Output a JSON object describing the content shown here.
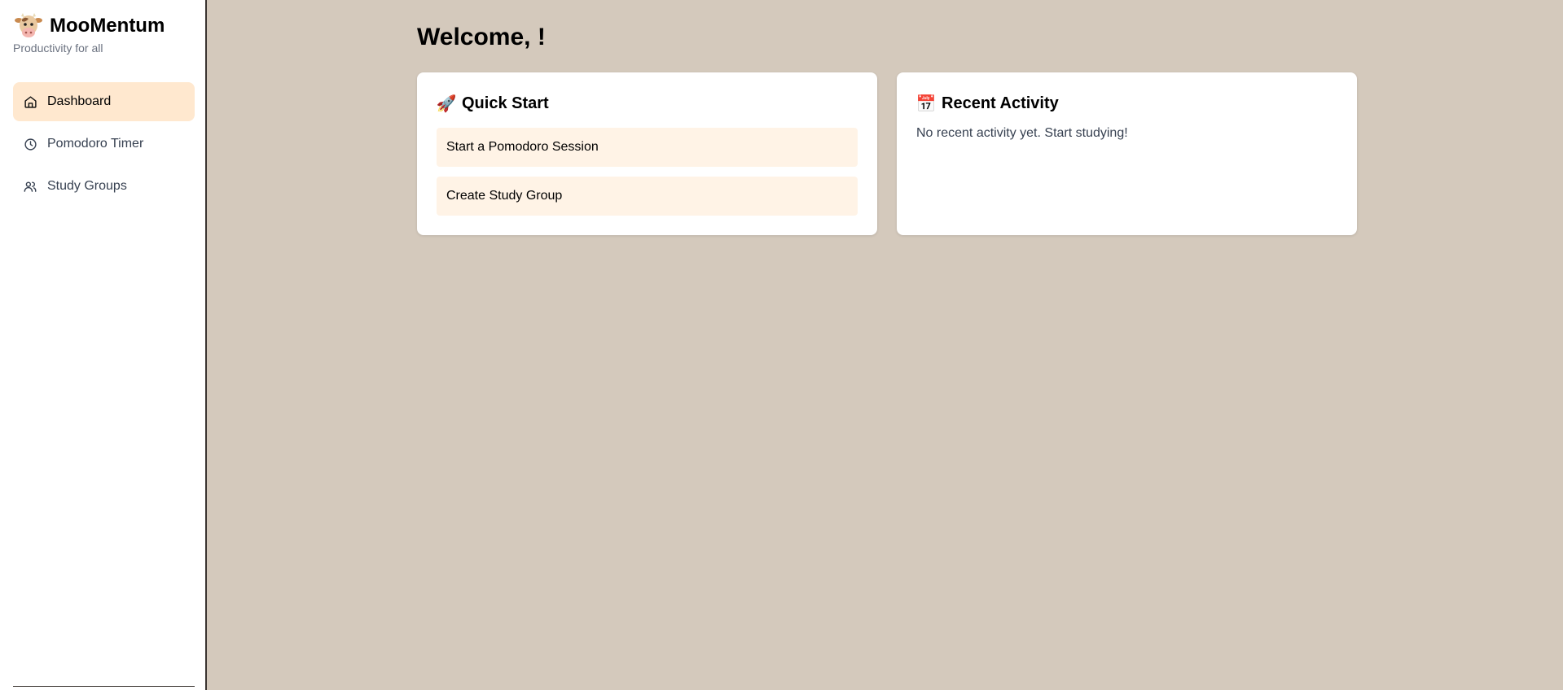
{
  "brand": {
    "name": "MooMentum",
    "tagline": "Productivity for all",
    "logo_icon": "cow-icon"
  },
  "sidebar": {
    "items": [
      {
        "label": "Dashboard",
        "icon": "home-icon",
        "active": true
      },
      {
        "label": "Pomodoro Timer",
        "icon": "clock-icon",
        "active": false
      },
      {
        "label": "Study Groups",
        "icon": "users-icon",
        "active": false
      }
    ]
  },
  "main": {
    "welcome": "Welcome, !",
    "quick_start": {
      "emoji": "🚀",
      "title": "Quick Start",
      "actions": [
        "Start a Pomodoro Session",
        "Create Study Group"
      ]
    },
    "recent_activity": {
      "emoji": "📅",
      "title": "Recent Activity",
      "empty_text": "No recent activity yet. Start studying!"
    }
  },
  "colors": {
    "background": "#d4c9bc",
    "active_nav": "#ffe8cf",
    "action_button": "#fff3e6"
  }
}
